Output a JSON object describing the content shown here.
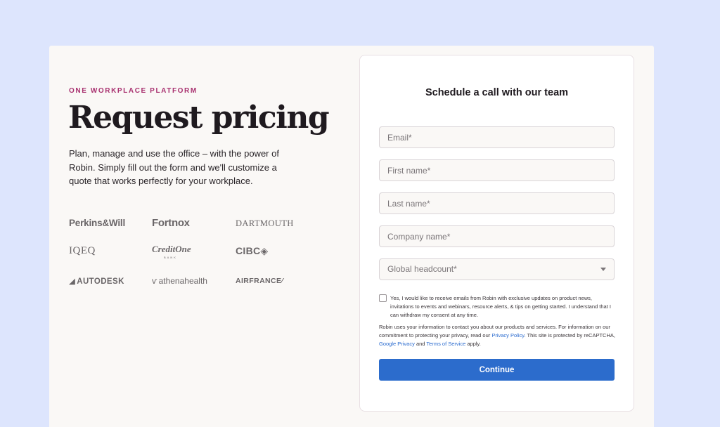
{
  "hero": {
    "eyebrow": "ONE WORKPLACE PLATFORM",
    "title": "Request pricing",
    "description": "Plan, manage and use the office – with the power of Robin. Simply fill out the form and we'll customize a quote that works perfectly for your workplace."
  },
  "logos": {
    "perkins_will": "Perkins&Will",
    "fortnox": "Fortnox",
    "dartmouth": "DARTMOUTH",
    "iqeq": "IQEQ",
    "creditone": "CreditOne",
    "creditone_sub": "BANK",
    "cibc": "CIBC",
    "cibc_glyph": "◈",
    "autodesk": "AUTODESK",
    "autodesk_glyph": "◢",
    "athenahealth": "athenahealth",
    "athenahealth_glyph": "ѵ",
    "airfrance": "AIRFRANCE",
    "airfrance_glyph": "⁄"
  },
  "form": {
    "title": "Schedule a call with our team",
    "email_placeholder": "Email*",
    "first_name_placeholder": "First name*",
    "last_name_placeholder": "Last name*",
    "company_placeholder": "Company name*",
    "headcount_placeholder": "Global headcount*",
    "consent_text": "Yes, I would like to receive emails from Robin with exclusive updates on product news, invitations to events and webinars, resource alerts, & tips on getting started. I understand that I can withdraw my consent at any time.",
    "privacy_text_1": "Robin uses your information to contact you about our products and services. For information on our commitment to protecting your privacy, read our ",
    "privacy_policy_link": "Privacy Policy",
    "privacy_text_2": ". This site is protected by reCAPTCHA, ",
    "google_privacy_link": "Google Privacy",
    "privacy_text_3": " and ",
    "terms_link": "Terms of Service",
    "privacy_text_4": " apply.",
    "continue_label": "Continue"
  },
  "colors": {
    "background": "#dde5fd",
    "panel": "#faf8f6",
    "eyebrow": "#a8306f",
    "primary_button": "#2c6ccc",
    "link": "#2a6bcf"
  }
}
